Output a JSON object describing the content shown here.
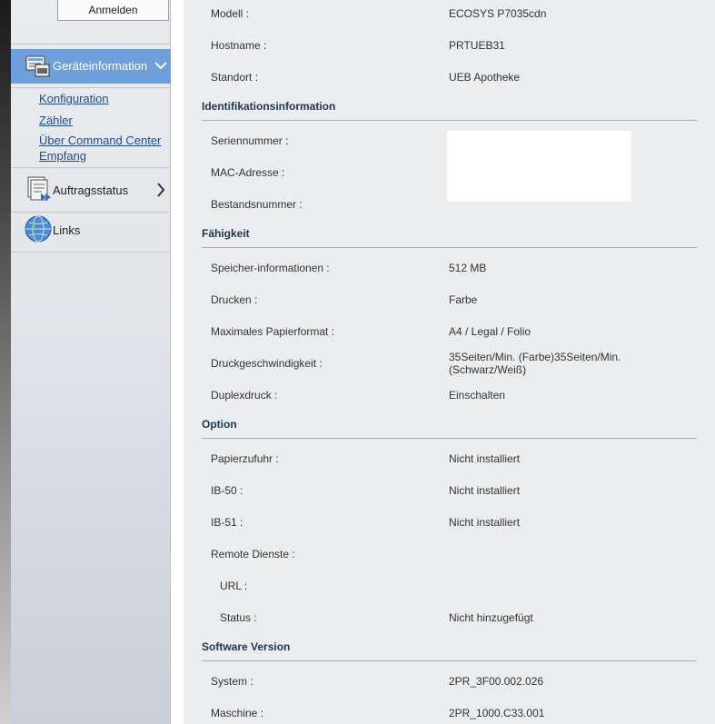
{
  "sidebar": {
    "login_label": "Anmelden",
    "active_item": {
      "label": "Geräteinformation",
      "icon": "device-info-icon"
    },
    "sublinks": [
      "Konfiguration",
      "Zähler",
      "Über Command Center",
      "Empfang"
    ],
    "items": [
      {
        "label": "Auftragsstatus",
        "icon": "job-status-icon"
      },
      {
        "label": "Links",
        "icon": "globe-icon"
      }
    ]
  },
  "main": {
    "top_rows": [
      {
        "label": "Modell :",
        "value": "ECOSYS P7035cdn"
      },
      {
        "label": "Hostname :",
        "value": "PRTUEB31"
      },
      {
        "label": "Standort :",
        "value": "UEB Apotheke"
      }
    ],
    "sections": {
      "identification": {
        "title": "Identifikationsinformation",
        "rows": [
          {
            "label": "Seriennummer :",
            "value": ""
          },
          {
            "label": "MAC-Adresse :",
            "value": ""
          },
          {
            "label": "Bestandsnummer :",
            "value": ""
          }
        ]
      },
      "capability": {
        "title": "Fähigkeit",
        "rows": [
          {
            "label": "Speicher-informationen :",
            "value": "512 MB"
          },
          {
            "label": "Drucken :",
            "value": "Farbe"
          },
          {
            "label": "Maximales Papierformat :",
            "value": "A4 / Legal / Folio"
          },
          {
            "label": "Druckgeschwindigkeit :",
            "value_line1": "35Seiten/Min. (Farbe)35Seiten/Min.",
            "value_line2": "(Schwarz/Weiß)"
          },
          {
            "label": "Duplexdruck :",
            "value": "Einschalten"
          }
        ]
      },
      "option": {
        "title": "Option",
        "rows": [
          {
            "label": "Papierzufuhr :",
            "value": "Nicht installiert"
          },
          {
            "label": "IB-50 :",
            "value": "Nicht installiert"
          },
          {
            "label": "IB-51 :",
            "value": "Nicht installiert"
          },
          {
            "label": "Remote Dienste :",
            "value": ""
          },
          {
            "label": "URL :",
            "value": ""
          },
          {
            "label": "Status :",
            "value": "Nicht hinzugefügt"
          }
        ]
      },
      "software": {
        "title": "Software Version",
        "rows": [
          {
            "label": "System :",
            "value": "2PR_3F00.002.026"
          },
          {
            "label": "Maschine :",
            "value": "2PR_1000.C33.001"
          }
        ]
      }
    }
  },
  "colors": {
    "active_nav": "#6d9fdd",
    "link": "#1f4a95",
    "heading": "#1d3557"
  }
}
